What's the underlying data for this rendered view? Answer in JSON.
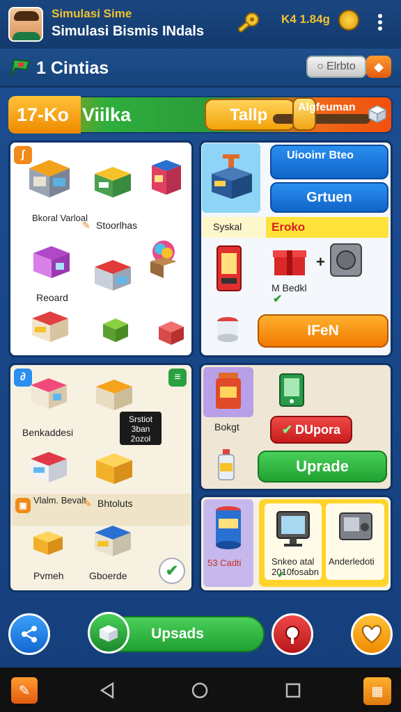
{
  "header": {
    "subtitle": "Simulasi Sime",
    "title": "Simulasi Bismis INdals",
    "coins": "K4 1.84g"
  },
  "subheader": {
    "level_label": "1 Cintias",
    "pill_button": "Elrbto"
  },
  "progress": {
    "number": "17-Ko",
    "label": "Viilka",
    "tap_label": "Tallp",
    "right_label": "Algfeuman",
    "fill": 0.3
  },
  "panel_shops": {
    "items": [
      {
        "label": "Bkoral Varloal"
      },
      {
        "label": "Stoorlhas"
      },
      {
        "label": "Reoard"
      }
    ]
  },
  "panel_upgrades": {
    "blue_button_1": "Uiooinr Bteo",
    "blue_button_2": "Grtuen",
    "left_label": "Syskal",
    "yellow_label": "Eroko",
    "item_label": "M Bedkl",
    "orange_button": "IFeN"
  },
  "panel_market": {
    "items": [
      {
        "label": "Benkaddesi"
      },
      {
        "label": "Vlalm. Bevalt"
      },
      {
        "label": "Bhtoluts"
      },
      {
        "label": "Pvmeh"
      },
      {
        "label": "Gboerde"
      }
    ],
    "sign_text": "Srstiot 3ban 2ozol"
  },
  "panel_actions": {
    "item_label": "Bokgt",
    "red_button": "DUpora",
    "green_button": "Uprade"
  },
  "panel_devices": {
    "left_label": "53 Cadti",
    "cards": [
      {
        "label": "Snkeo atal 2010fosabn"
      },
      {
        "label": "Anderledoti"
      }
    ]
  },
  "bottom": {
    "upgrade_button": "Upsads"
  },
  "colors": {
    "background": "#1d4f93",
    "accent_gold": "#f2c230",
    "green": "#2fae3c",
    "orange": "#f07a00"
  }
}
